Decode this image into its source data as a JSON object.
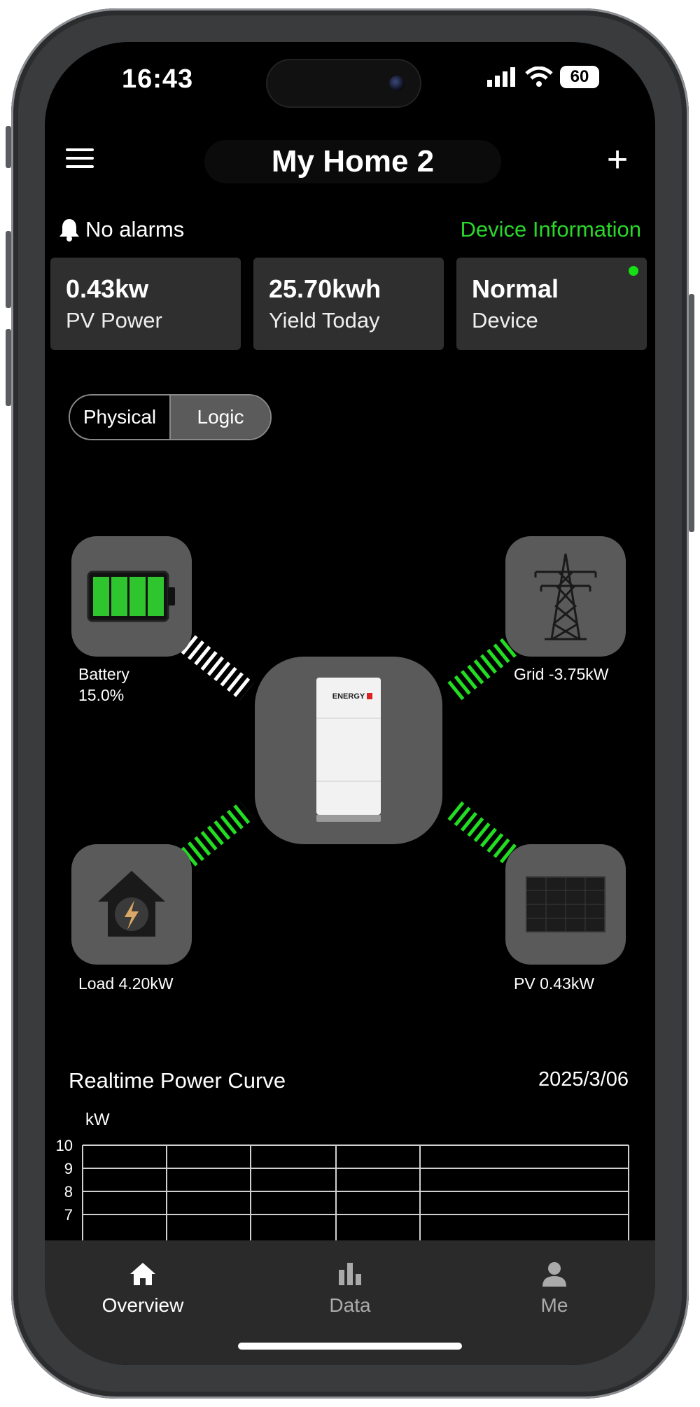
{
  "status_bar": {
    "time": "16:43",
    "battery": "60"
  },
  "header": {
    "title": "My Home 2"
  },
  "alarm": {
    "text": "No alarms"
  },
  "device_info_link": "Device Information",
  "summary_cards": [
    {
      "value": "0.43kw",
      "label": "PV Power"
    },
    {
      "value": "25.70kwh",
      "label": "Yield Today"
    },
    {
      "value": "Normal",
      "label": "Device"
    }
  ],
  "view_toggle": {
    "options": [
      "Physical",
      "Logic"
    ],
    "selected": "Physical"
  },
  "energy_flow": {
    "battery": {
      "label": "Battery",
      "value": "15.0%",
      "level": 0.9
    },
    "grid": {
      "label": "Grid -3.75kW"
    },
    "load": {
      "label": "Load 4.20kW"
    },
    "pv": {
      "label": "PV 0.43kW"
    },
    "inverter_brand": "ENERGY"
  },
  "chart": {
    "title": "Realtime Power Curve",
    "date": "2025/3/06",
    "unit": "kW"
  },
  "chart_data": {
    "type": "line",
    "title": "Realtime Power Curve",
    "ylabel": "kW",
    "yticks": [
      10,
      9,
      8,
      7
    ],
    "ylim": [
      7,
      10
    ],
    "grid": true,
    "series": []
  },
  "tabbar": [
    {
      "label": "Overview",
      "icon": "home-icon",
      "active": true
    },
    {
      "label": "Data",
      "icon": "bar-chart-icon",
      "active": false
    },
    {
      "label": "Me",
      "icon": "person-icon",
      "active": false
    }
  ],
  "colors": {
    "accent": "#2bd62b",
    "flow_active": "#22dd22",
    "flow_idle": "#ffffff",
    "card_bg": "#2f2f2f"
  }
}
